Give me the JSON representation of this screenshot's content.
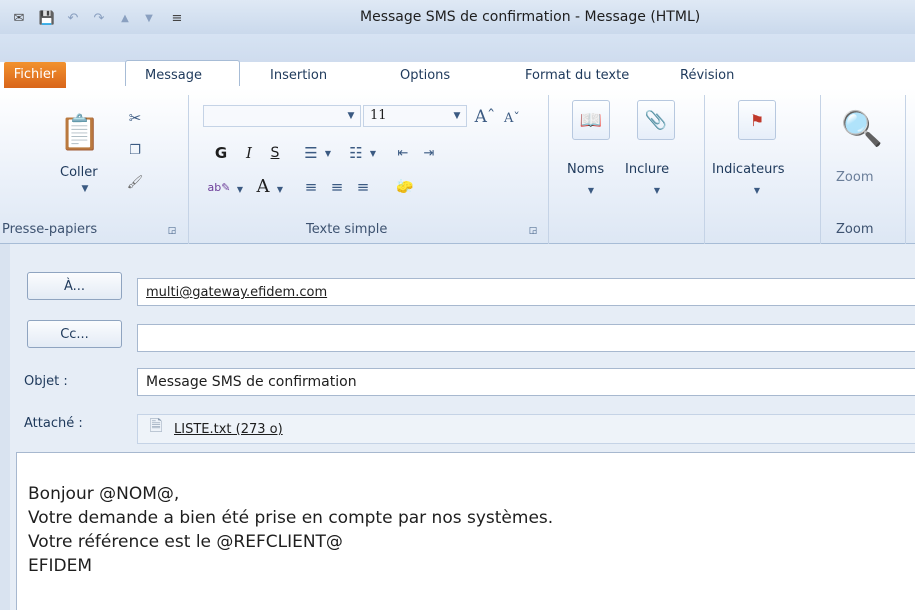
{
  "window": {
    "title": "Message SMS de confirmation  -  Message (HTML)"
  },
  "quick_access": {
    "icons": [
      "app-icon",
      "save-icon",
      "undo-icon",
      "redo-icon",
      "up-arrow-icon",
      "down-arrow-icon",
      "customize-icon"
    ],
    "glyphs": {
      "app": "✉",
      "save": "💾",
      "undo": "↶",
      "redo": "↷",
      "up": "▲",
      "down": "▼",
      "customize": "≡"
    }
  },
  "tabs": [
    {
      "label": "Fichier"
    },
    {
      "label": "Message"
    },
    {
      "label": "Insertion"
    },
    {
      "label": "Options"
    },
    {
      "label": "Format du texte"
    },
    {
      "label": "Révision"
    }
  ],
  "ribbon": {
    "clipboard": {
      "paste_label": "Coller",
      "group_label": "Presse-papiers"
    },
    "basic_text": {
      "font_size": "11",
      "bold": "G",
      "italic": "I",
      "underline": "S",
      "font_color": "A",
      "group_label": "Texte simple"
    },
    "names": {
      "label": "Noms"
    },
    "include": {
      "label": "Inclure"
    },
    "tags": {
      "label": "Indicateurs"
    },
    "zoom": {
      "label": "Zoom",
      "group_label": "Zoom"
    }
  },
  "form": {
    "to_button": "À...",
    "to_value": "multi@gateway.efidem.com",
    "cc_button": "Cc...",
    "cc_value": "",
    "subject_label": "Objet :",
    "subject_value": "Message SMS de confirmation",
    "attached_label": "Attaché :",
    "attachment": "LISTE.txt (273 o)"
  },
  "body": {
    "lines": [
      "Bonjour @NOM@,",
      "Votre demande a bien été prise en compte par nos systèmes.",
      "Votre référence est le @REFCLIENT@",
      "EFIDEM"
    ]
  },
  "colors": {
    "file_tab": "#e1762a",
    "ribbon_bg": "#e7eef8",
    "text": "#1e395b"
  }
}
